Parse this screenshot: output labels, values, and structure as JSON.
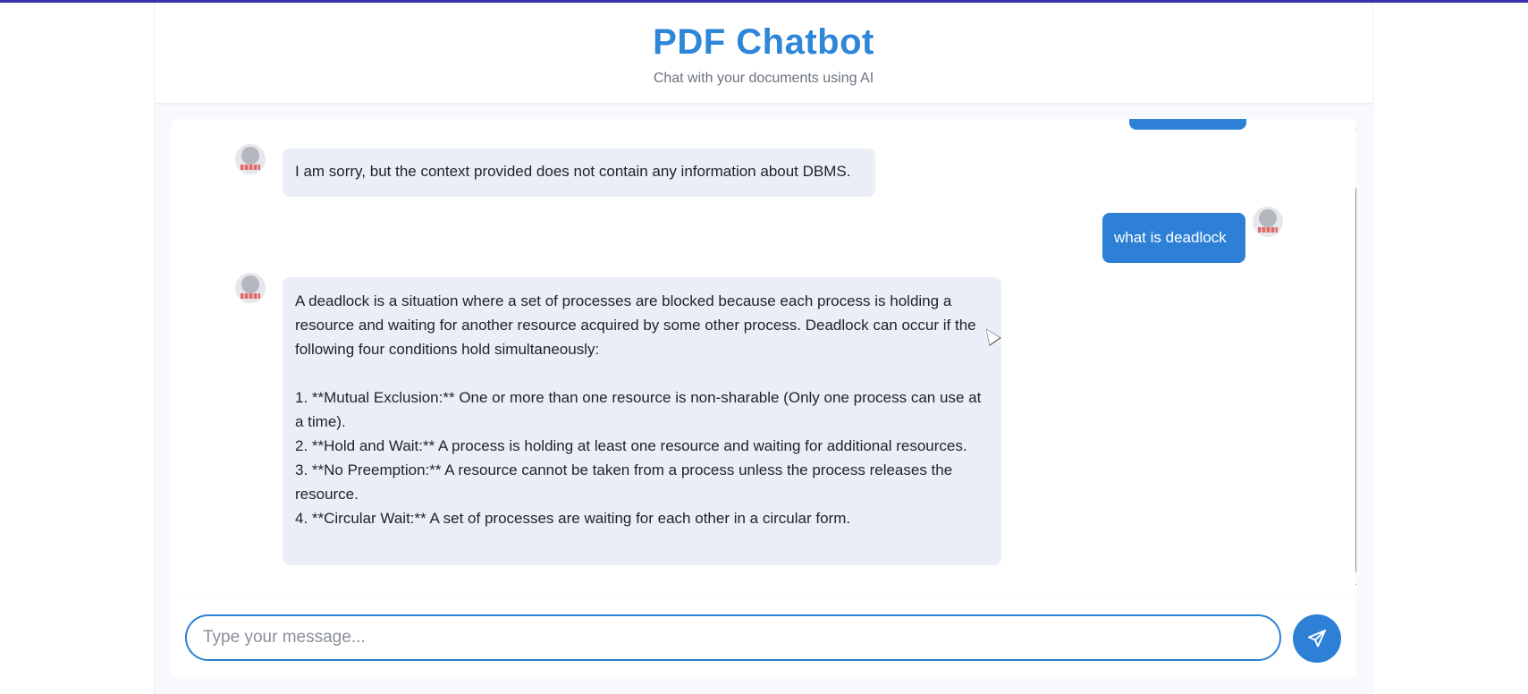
{
  "header": {
    "title": "PDF Chatbot",
    "subtitle": "Chat with your documents using AI"
  },
  "messages": [
    {
      "role": "bot",
      "text": "I am sorry, but the context provided does not contain any information about DBMS."
    },
    {
      "role": "user",
      "text": "what is deadlock"
    },
    {
      "role": "bot",
      "intro": "A deadlock is a situation where a set of processes are blocked because each process is holding a resource and waiting for another resource acquired by some other process. Deadlock can occur if the following four conditions hold simultaneously:",
      "items": [
        "1.  **Mutual Exclusion:** One or more than one resource is non-sharable (Only one process can use at a time).",
        "2.  **Hold and Wait:** A process is holding at least one resource and waiting for additional resources.",
        "3.  **No Preemption:** A resource cannot be taken from a process unless the process releases the resource.",
        "4.  **Circular Wait:** A set of processes are waiting for each other in a circular form."
      ]
    }
  ],
  "composer": {
    "placeholder": "Type your message...",
    "send_icon": "send-icon"
  },
  "colors": {
    "accent": "#2d80d6",
    "bot_bubble": "#eaeef6",
    "top_bar": "#3b2fb0"
  }
}
